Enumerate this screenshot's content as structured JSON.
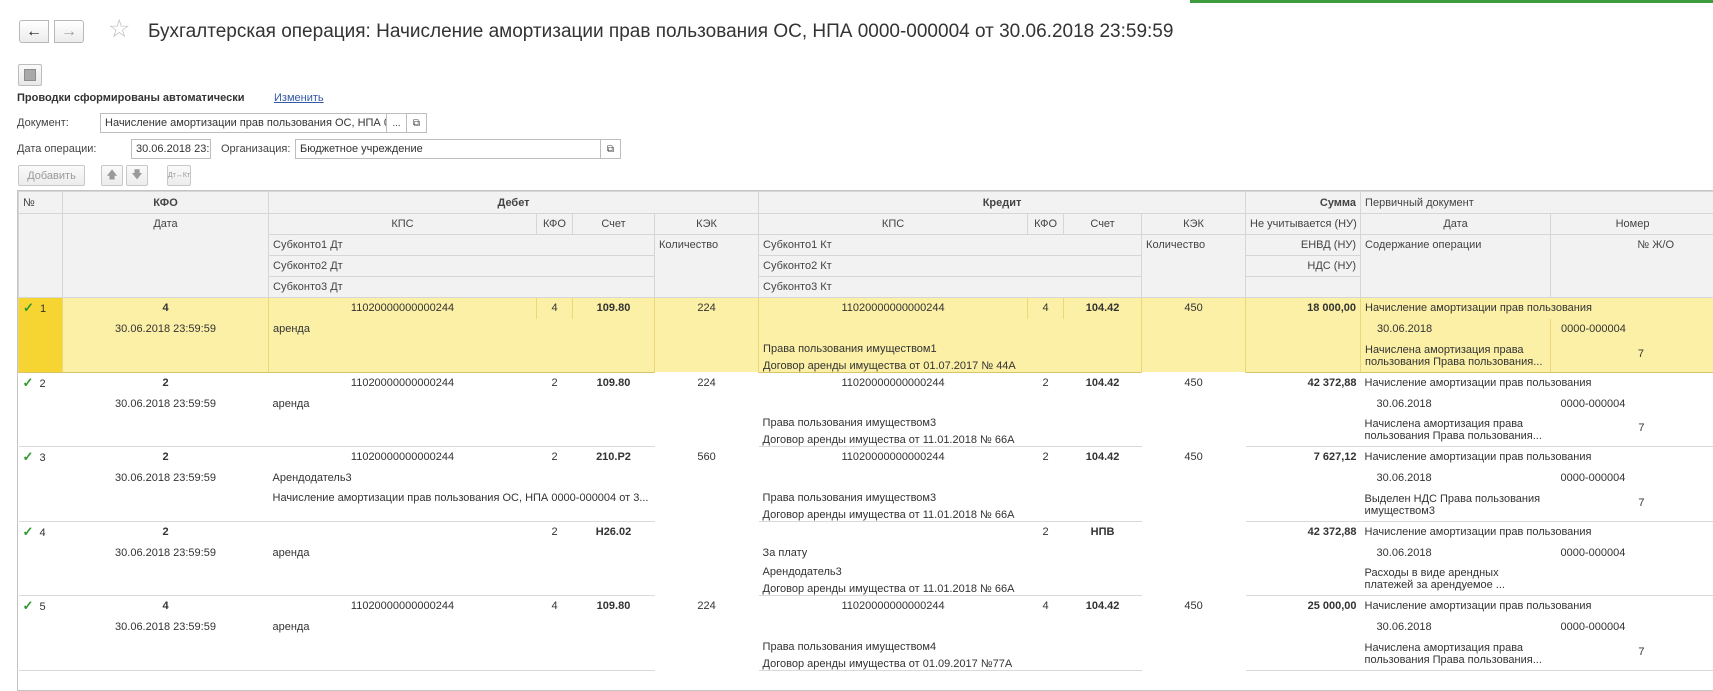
{
  "window": {
    "title": "Бухгалтерская операция: Начисление амортизации прав пользования ОС, НПА 0000-000004 от 30.06.2018 23:59:59"
  },
  "nav": {
    "back_icon": "←",
    "forward_icon": "→",
    "star_icon": "☆"
  },
  "form": {
    "auto_label": "Проводки сформированы автоматически",
    "change_link": "Изменить",
    "doc_label": "Документ:",
    "doc_value": "Начисление амортизации прав пользования ОС, НПА 0",
    "doc_ellipsis": "...",
    "open_icon": "⧉",
    "date_label": "Дата операции:",
    "date_value": "30.06.2018 23:59:59",
    "org_label": "Организация:",
    "org_value": "Бюджетное учреждение"
  },
  "toolbar": {
    "add_label": "Добавить",
    "up_icon": "🡅",
    "down_icon": "🡇",
    "swap_label": "Дт↔Кт"
  },
  "table": {
    "headers": {
      "num": "№",
      "kfo": "КФО",
      "debet": "Дебет",
      "kredit": "Кредит",
      "summa": "Сумма",
      "primary": "Первичный документ",
      "date": "Дата",
      "kps": "КПС",
      "kfo_short": "КФО",
      "schet": "Счет",
      "kek": "КЭК",
      "not_counted": "Не учитывается (НУ)",
      "p_date": "Дата",
      "p_num": "Номер",
      "sub1_dt": "Субконто1 Дт",
      "sub2_dt": "Субконто2 Дт",
      "sub3_dt": "Субконто3 Дт",
      "qty_dt": "Количество",
      "sub1_kt": "Субконто1 Кт",
      "sub2_kt": "Субконто2 Кт",
      "sub3_kt": "Субконто3 Кт",
      "qty_kt": "Количество",
      "envd": "ЕНВД (НУ)",
      "nds": "НДС (НУ)",
      "content": "Содержание операции",
      "jo": "№ Ж/О"
    },
    "rows": [
      {
        "check": "✓",
        "num": "1",
        "kfo": "4",
        "date": "30.06.2018 23:59:59",
        "dt_kps": "11020000000000244",
        "dt_kfo": "4",
        "dt_schet": "109.80",
        "dt_kek": "224",
        "dt_sub1": "аренда",
        "dt_sub2": "",
        "dt_sub3": "",
        "kt_kps": "11020000000000244",
        "kt_kfo": "4",
        "kt_schet": "104.42",
        "kt_kek": "450",
        "kt_sub1": "",
        "kt_sub2": "Права пользования имуществом1",
        "kt_sub3": "Договор аренды имущества от 01.07.2017 № 44А",
        "summa": "18 000,00",
        "doc_title": "Начисление амортизации прав пользования",
        "doc_date": "30.06.2018",
        "doc_num": "0000-000004",
        "content": "Начислена амортизация права пользования Права пользования...",
        "jo": "7"
      },
      {
        "check": "✓",
        "num": "2",
        "kfo": "2",
        "date": "30.06.2018 23:59:59",
        "dt_kps": "11020000000000244",
        "dt_kfo": "2",
        "dt_schet": "109.80",
        "dt_kek": "224",
        "dt_sub1": "аренда",
        "dt_sub2": "",
        "dt_sub3": "",
        "kt_kps": "11020000000000244",
        "kt_kfo": "2",
        "kt_schet": "104.42",
        "kt_kek": "450",
        "kt_sub1": "",
        "kt_sub2": "Права пользования имуществом3",
        "kt_sub3": "Договор аренды имущества от 11.01.2018 № 66А",
        "summa": "42 372,88",
        "doc_title": "Начисление амортизации прав пользования",
        "doc_date": "30.06.2018",
        "doc_num": "0000-000004",
        "content": "Начислена амортизация права пользования Права пользования...",
        "jo": "7"
      },
      {
        "check": "✓",
        "num": "3",
        "kfo": "2",
        "date": "30.06.2018 23:59:59",
        "dt_kps": "11020000000000244",
        "dt_kfo": "2",
        "dt_schet": "210.Р2",
        "dt_kek": "560",
        "dt_sub1": "Арендодатель3",
        "dt_sub2": "Начисление амортизации прав пользования ОС, НПА 0000-000004 от 3...",
        "dt_sub3": "",
        "kt_kps": "11020000000000244",
        "kt_kfo": "2",
        "kt_schet": "104.42",
        "kt_kek": "450",
        "kt_sub1": "",
        "kt_sub2": "Права пользования имуществом3",
        "kt_sub3": "Договор аренды имущества от 11.01.2018 № 66А",
        "summa": "7 627,12",
        "doc_title": "Начисление амортизации прав пользования",
        "doc_date": "30.06.2018",
        "doc_num": "0000-000004",
        "content": "Выделен НДС Права пользования имуществом3",
        "jo": "7"
      },
      {
        "check": "✓",
        "num": "4",
        "kfo": "2",
        "date": "30.06.2018 23:59:59",
        "dt_kps": "",
        "dt_kfo": "2",
        "dt_schet": "Н26.02",
        "dt_kek": "",
        "dt_sub1": "аренда",
        "dt_sub2": "",
        "dt_sub3": "",
        "kt_kps": "",
        "kt_kfo": "2",
        "kt_schet": "НПВ",
        "kt_kek": "",
        "kt_sub1": "За плату",
        "kt_sub2": "Арендодатель3",
        "kt_sub3": "Договор аренды имущества от 11.01.2018 № 66А",
        "summa": "42 372,88",
        "doc_title": "Начисление амортизации прав пользования",
        "doc_date": "30.06.2018",
        "doc_num": "0000-000004",
        "content": "Расходы в виде арендных платежей за арендуемое ...",
        "jo": ""
      },
      {
        "check": "✓",
        "num": "5",
        "kfo": "4",
        "date": "30.06.2018 23:59:59",
        "dt_kps": "11020000000000244",
        "dt_kfo": "4",
        "dt_schet": "109.80",
        "dt_kek": "224",
        "dt_sub1": "аренда",
        "dt_sub2": "",
        "dt_sub3": "",
        "kt_kps": "11020000000000244",
        "kt_kfo": "4",
        "kt_schet": "104.42",
        "kt_kek": "450",
        "kt_sub1": "",
        "kt_sub2": "Права пользования имуществом4",
        "kt_sub3": "Договор аренды имущества от 01.09.2017 №77А",
        "summa": "25 000,00",
        "doc_title": "Начисление амортизации прав пользования",
        "doc_date": "30.06.2018",
        "doc_num": "0000-000004",
        "content": "Начислена амортизация права пользования Права пользования...",
        "jo": "7"
      }
    ]
  }
}
